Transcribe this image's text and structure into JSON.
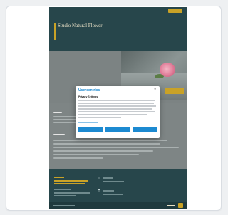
{
  "colors": {
    "header_bg": "#27464b",
    "accent_gold": "#c9a227",
    "page_gray": "#7e8585",
    "consent_blue": "#1d8ad1"
  },
  "site": {
    "logo_title": "Studio Natural Flower",
    "logo_icon": "flower-icon"
  },
  "cookie_dialog": {
    "brand": "Usercentrics",
    "close_icon": "close-icon",
    "title": "Privacy Settings"
  }
}
